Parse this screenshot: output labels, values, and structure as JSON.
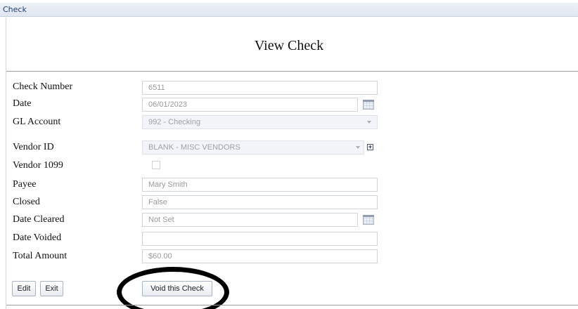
{
  "window": {
    "title": "Check"
  },
  "page": {
    "heading": "View Check"
  },
  "form": {
    "check_number": {
      "label": "Check Number",
      "value": "6511"
    },
    "date": {
      "label": "Date",
      "value": "06/01/2023"
    },
    "gl_account": {
      "label": "GL Account",
      "value": "992 - Checking"
    },
    "vendor_id": {
      "label": "Vendor ID",
      "value": "BLANK - MISC VENDORS"
    },
    "vendor_1099": {
      "label": "Vendor 1099",
      "checked": false
    },
    "payee": {
      "label": "Payee",
      "value": "Mary Smith"
    },
    "closed": {
      "label": "Closed",
      "value": "False"
    },
    "date_cleared": {
      "label": "Date Cleared",
      "value": "Not Set"
    },
    "date_voided": {
      "label": "Date Voided",
      "value": ""
    },
    "total_amount": {
      "label": "Total Amount",
      "value": "$60.00"
    }
  },
  "buttons": {
    "edit": "Edit",
    "exit": "Exit",
    "void": "Void this Check"
  },
  "icons": {
    "calendar": "calendar-icon",
    "dropdown": "chevron-down-icon",
    "add": "plus-icon"
  }
}
